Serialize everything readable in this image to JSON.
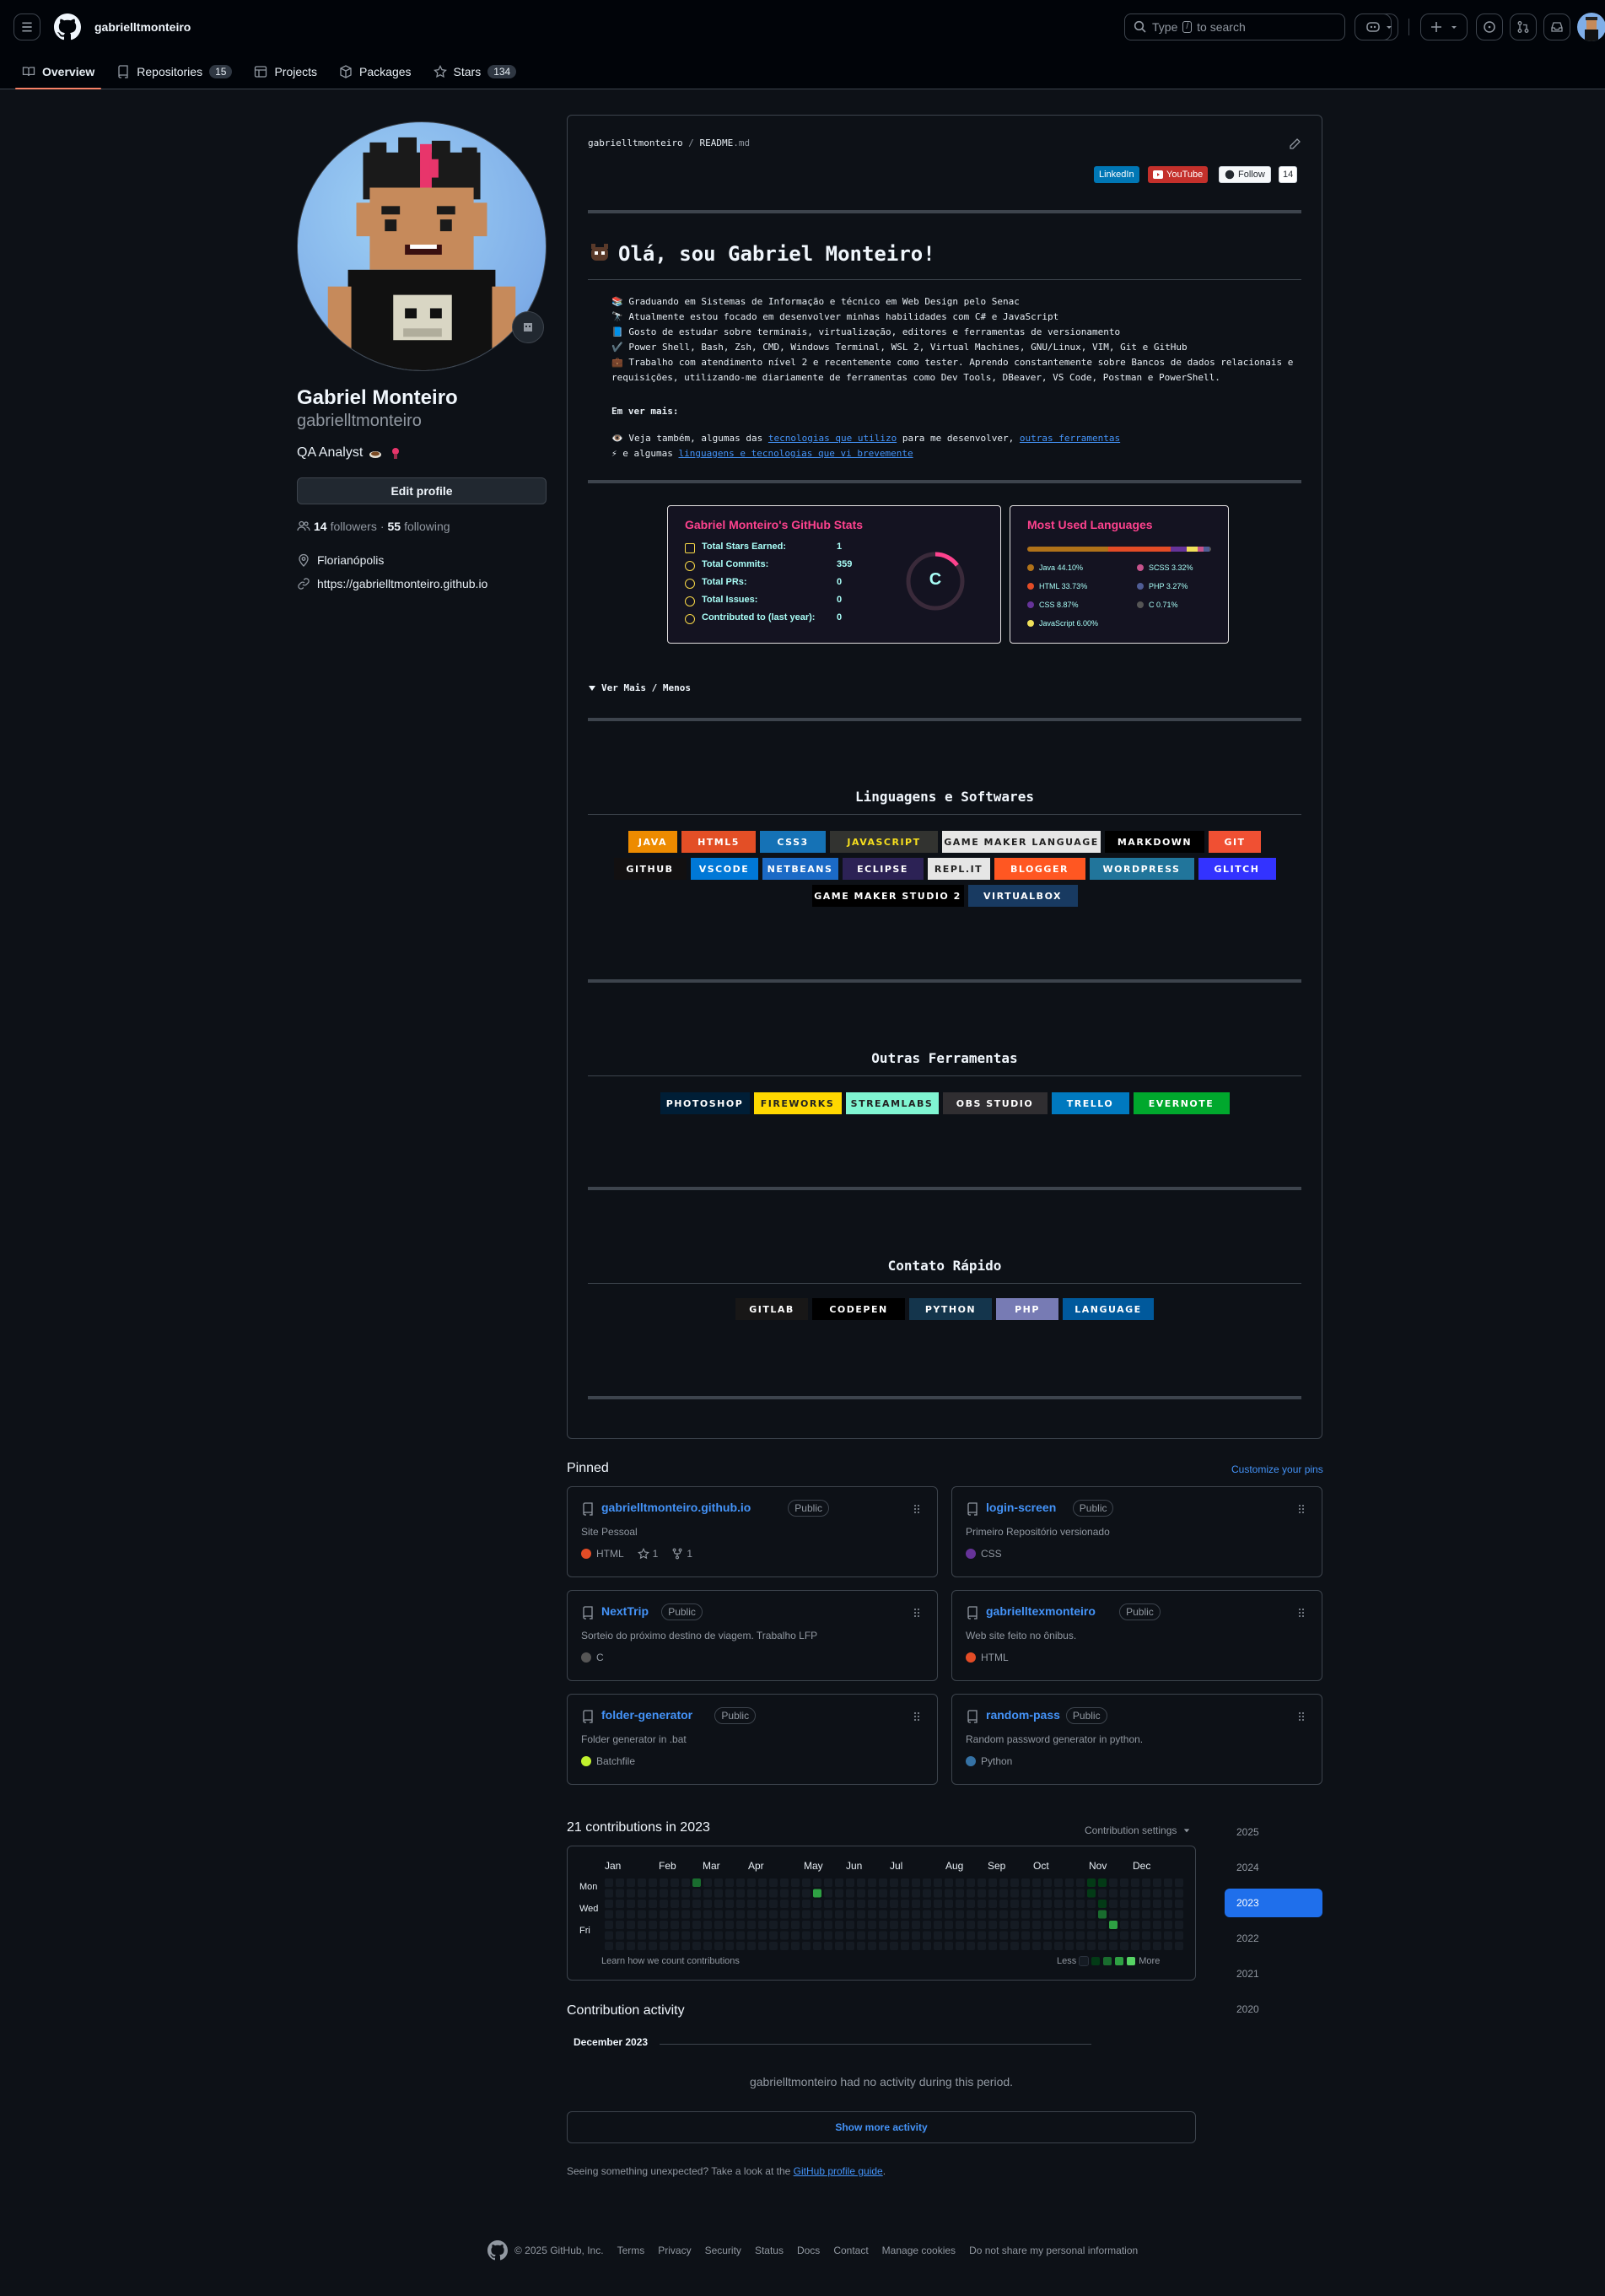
{
  "header": {
    "username": "gabrielltmonteiro",
    "search_placeholder_pre": "Type",
    "search_key": "/",
    "search_placeholder_post": "to search"
  },
  "nav": {
    "tabs": [
      {
        "label": "Overview",
        "count": null,
        "icon": "book-icon"
      },
      {
        "label": "Repositories",
        "count": "15",
        "icon": "repo-icon"
      },
      {
        "label": "Projects",
        "count": null,
        "icon": "table-icon"
      },
      {
        "label": "Packages",
        "count": null,
        "icon": "package-icon"
      },
      {
        "label": "Stars",
        "count": "134",
        "icon": "star-icon"
      }
    ]
  },
  "profile": {
    "name": "Gabriel Monteiro",
    "login": "gabrielltmonteiro",
    "bio": "QA Analyst",
    "edit_label": "Edit profile",
    "followers": "14",
    "followers_label": "followers",
    "sep": "·",
    "following": "55",
    "following_label": "following",
    "location": "Florianópolis",
    "website": "https://gabrielltmonteiro.github.io"
  },
  "readme": {
    "path_user": "gabrielltmonteiro",
    "path_sep": "/",
    "path_file": "README",
    "path_ext": ".md",
    "badges": {
      "linkedin": "LinkedIn",
      "youtube": "YouTube",
      "follow": "Follow",
      "follow_count": "14"
    },
    "heading": "Olá, sou Gabriel Monteiro!",
    "lines": [
      "📚 Graduando em Sistemas de Informação e técnico em Web Design pelo Senac",
      "🔭 Atualmente estou focado em desenvolver minhas habilidades com C# e JavaScript",
      "📘 Gosto de estudar sobre terminais, virtualização, editores e ferramentas de versionamento",
      "✔️ Power Shell, Bash, Zsh, CMD, Windows Terminal, WSL 2, Virtual Machines, GNU/Linux, VIM, Git e GitHub",
      "💼 Trabalho com atendimento nível 2 e recentemente como tester. Aprendo constantemente sobre Bancos de dados relacionais e",
      "requisições, utilizando-me diariamente de ferramentas como Dev Tools, DBeaver, VS Code, Postman e PowerShell."
    ],
    "em_ver_mais": "Em ver mais:",
    "see_also_pre": "👁️ Veja também, algumas das",
    "see_also_link1": "tecnologias que utilizo",
    "see_also_mid": "para me desenvolver,",
    "see_also_link2": "outras ferramentas",
    "and_some_pre": "⚡ e algumas",
    "and_some_link": "linguagens e tecnologias que vi brevemente",
    "stats": {
      "title": "Gabriel Monteiro's GitHub Stats",
      "rows": [
        {
          "label": "Total Stars Earned:",
          "value": "1"
        },
        {
          "label": "Total Commits:",
          "value": "359"
        },
        {
          "label": "Total PRs:",
          "value": "0"
        },
        {
          "label": "Total Issues:",
          "value": "0"
        },
        {
          "label": "Contributed to (last year):",
          "value": "0"
        }
      ],
      "grade": "C"
    },
    "langs": {
      "title": "Most Used Languages",
      "items": [
        {
          "name": "Java",
          "pct": 44.1,
          "label": "Java 44.10%",
          "color": "#b07219"
        },
        {
          "name": "HTML",
          "pct": 33.73,
          "label": "HTML 33.73%",
          "color": "#e34c26"
        },
        {
          "name": "CSS",
          "pct": 8.87,
          "label": "CSS 8.87%",
          "color": "#663399"
        },
        {
          "name": "JavaScript",
          "pct": 6.0,
          "label": "JavaScript 6.00%",
          "color": "#f1e05a"
        },
        {
          "name": "SCSS",
          "pct": 3.32,
          "label": "SCSS 3.32%",
          "color": "#c6538c"
        },
        {
          "name": "PHP",
          "pct": 3.27,
          "label": "PHP 3.27%",
          "color": "#4F5D95"
        },
        {
          "name": "C",
          "pct": 0.71,
          "label": "C 0.71%",
          "color": "#555555"
        }
      ]
    },
    "details_summary": "Ver Mais / Menos",
    "sections": {
      "langs": "Linguagens e Softwares",
      "tools": "Outras Ferramentas",
      "contact": "Contato Rápido"
    },
    "tech_badges": {
      "row1": [
        {
          "label": "JAVA",
          "bg": "#ED8B00",
          "fg": "#ffffff"
        },
        {
          "label": "HTML5",
          "bg": "#E34F26",
          "fg": "#ffffff"
        },
        {
          "label": "CSS3",
          "bg": "#1572B6",
          "fg": "#ffffff"
        },
        {
          "label": "JAVASCRIPT",
          "bg": "#323330",
          "fg": "#F7DF1E"
        },
        {
          "label": "GAME MAKER LANGUAGE",
          "bg": "#e6e6e6",
          "fg": "#222222"
        },
        {
          "label": "MARKDOWN",
          "bg": "#000000",
          "fg": "#ffffff"
        },
        {
          "label": "GIT",
          "bg": "#F05033",
          "fg": "#ffffff"
        }
      ],
      "row2": [
        {
          "label": "GITHUB",
          "bg": "#121011",
          "fg": "#ffffff"
        },
        {
          "label": "VSCODE",
          "bg": "#0078d7",
          "fg": "#ffffff"
        },
        {
          "label": "NETBEANS",
          "bg": "#1B6AC6",
          "fg": "#ffffff"
        },
        {
          "label": "ECLIPSE",
          "bg": "#2C2255",
          "fg": "#ffffff"
        },
        {
          "label": "REPL.IT",
          "bg": "#e6e6e6",
          "fg": "#222222"
        },
        {
          "label": "BLOGGER",
          "bg": "#FF5722",
          "fg": "#ffffff"
        },
        {
          "label": "WORDPRESS",
          "bg": "#21759B",
          "fg": "#ffffff"
        },
        {
          "label": "GLITCH",
          "bg": "#3333FF",
          "fg": "#ffffff"
        }
      ],
      "row3": [
        {
          "label": "GAME MAKER STUDIO 2",
          "bg": "#000000",
          "fg": "#ffffff"
        },
        {
          "label": "VIRTUALBOX",
          "bg": "#183A61",
          "fg": "#ffffff"
        }
      ],
      "tools": [
        {
          "label": "PHOTOSHOP",
          "bg": "#001e36",
          "fg": "#ffffff"
        },
        {
          "label": "FIREWORKS",
          "bg": "#FFD800",
          "fg": "#222222"
        },
        {
          "label": "STREAMLABS",
          "bg": "#80F5D2",
          "fg": "#222222"
        },
        {
          "label": "OBS STUDIO",
          "bg": "#302E31",
          "fg": "#ffffff"
        },
        {
          "label": "TRELLO",
          "bg": "#0079BF",
          "fg": "#ffffff"
        },
        {
          "label": "EVERNOTE",
          "bg": "#00A82D",
          "fg": "#ffffff"
        }
      ],
      "contact": [
        {
          "label": "GITLAB",
          "bg": "#181717",
          "fg": "#ffffff"
        },
        {
          "label": "CODEPEN",
          "bg": "#000000",
          "fg": "#ffffff"
        },
        {
          "label": "PYTHON",
          "bg": "#14354C",
          "fg": "#ffffff"
        },
        {
          "label": "PHP",
          "bg": "#777BB4",
          "fg": "#ffffff"
        },
        {
          "label": "LANGUAGE",
          "bg": "#00599C",
          "fg": "#ffffff"
        }
      ]
    }
  },
  "pinned": {
    "title": "Pinned",
    "customize": "Customize your pins",
    "items": [
      {
        "name": "gabrielltmonteiro.github.io",
        "vis": "Public",
        "desc": "Site Pessoal",
        "lang": "HTML",
        "color": "#e34c26",
        "stars": "1",
        "forks": "1"
      },
      {
        "name": "login-screen",
        "vis": "Public",
        "desc": "Primeiro Repositório versionado",
        "lang": "CSS",
        "color": "#663399",
        "stars": null,
        "forks": null
      },
      {
        "name": "NextTrip",
        "vis": "Public",
        "desc": "Sorteio do próximo destino de viagem. Trabalho LFP",
        "lang": "C",
        "color": "#555555",
        "stars": null,
        "forks": null
      },
      {
        "name": "gabrielltexmonteiro",
        "vis": "Public",
        "desc": "Web site feito no ônibus.",
        "lang": "HTML",
        "color": "#e34c26",
        "stars": null,
        "forks": null
      },
      {
        "name": "folder-generator",
        "vis": "Public",
        "desc": "Folder generator in .bat",
        "lang": "Batchfile",
        "color": "#C1F12E",
        "stars": null,
        "forks": null
      },
      {
        "name": "random-pass",
        "vis": "Public",
        "desc": "Random password generator in python.",
        "lang": "Python",
        "color": "#3572A5",
        "stars": null,
        "forks": null
      }
    ]
  },
  "contributions": {
    "title": "21 contributions in 2023",
    "settings": "Contribution settings",
    "months": [
      "Jan",
      "Feb",
      "Mar",
      "Apr",
      "May",
      "Jun",
      "Jul",
      "Aug",
      "Sep",
      "Oct",
      "Nov",
      "Dec"
    ],
    "days": [
      "Mon",
      "Wed",
      "Fri"
    ],
    "learn": "Learn how we count contributions",
    "less": "Less",
    "more": "More",
    "active_cells": [
      {
        "week": 8,
        "day": 0,
        "level": 2
      },
      {
        "week": 19,
        "day": 1,
        "level": 3
      },
      {
        "week": 44,
        "day": 0,
        "level": 1
      },
      {
        "week": 44,
        "day": 1,
        "level": 1
      },
      {
        "week": 45,
        "day": 0,
        "level": 1
      },
      {
        "week": 45,
        "day": 2,
        "level": 1
      },
      {
        "week": 45,
        "day": 3,
        "level": 2
      },
      {
        "week": 46,
        "day": 4,
        "level": 3
      }
    ],
    "years": [
      "2025",
      "2024",
      "2023",
      "2022",
      "2021",
      "2020"
    ],
    "selected_year": "2023"
  },
  "activity": {
    "title": "Contribution activity",
    "month": "December 2023",
    "none": "gabrielltmonteiro had no activity during this period.",
    "show_more": "Show more activity",
    "unexpected_pre": "Seeing something unexpected? Take a look at the",
    "unexpected_link": "GitHub profile guide",
    "unexpected_post": "."
  },
  "footer": {
    "copyright": "© 2025 GitHub, Inc.",
    "links": [
      "Terms",
      "Privacy",
      "Security",
      "Status",
      "Docs",
      "Contact",
      "Manage cookies",
      "Do not share my personal information"
    ]
  }
}
